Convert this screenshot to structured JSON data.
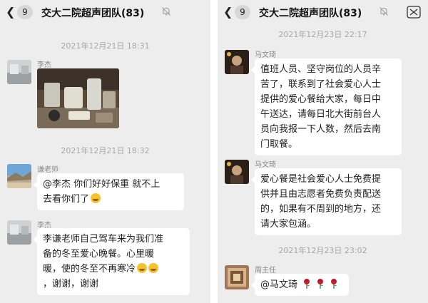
{
  "left_panel": {
    "header": {
      "back_count": "9",
      "title": "交大二院超声团队(83)"
    },
    "timestamps": [
      "2021年12月21日 18:31",
      "2021年12月21日 18:32"
    ],
    "messages": [
      {
        "sender": "李杰",
        "type": "image"
      },
      {
        "sender": "谦老师",
        "text_lines": [
          "@李杰 你们好好保重 就不上",
          "去看你们了"
        ],
        "trailing_emoji": "laughing-crying-emoji"
      },
      {
        "sender": "李杰",
        "text_lines": [
          "李谦老师自己驾车来为我们准",
          "备的冬至爱心晚餐。心里暖",
          "暖，使的冬至不再寒冷",
          "，谢谢，谢谢"
        ],
        "inline_emoji_count": 2
      }
    ]
  },
  "right_panel": {
    "header": {
      "back_count": "9",
      "title": "交大二院超声团队(83)"
    },
    "timestamps": [
      "2021年12月23日 22:17",
      "2021年12月23日 23:02"
    ],
    "messages": [
      {
        "sender": "马文琦",
        "text_lines": [
          "值班人员、坚守岗位的人员辛",
          "苦了，联系到了社会爱心人士",
          "提供的爱心餐给大家，每日中",
          "午送达，请每日北大街前台人",
          "员向我报一下人数，然后去南",
          "门取餐。"
        ]
      },
      {
        "sender": "马文琦",
        "text_lines": [
          "爱心餐是社会爱心人士免费提",
          "供并且由志愿者免费负责配送",
          "的，如果有不周到的地方，还",
          "请大家包涵。"
        ]
      },
      {
        "sender": "周主任",
        "text": "@马文琦",
        "trailing_emoji": "rose-emoji",
        "emoji_count": 3
      }
    ]
  },
  "icons": {
    "back": "chevron-left-icon",
    "mute": "mute-bell-icon",
    "more": "more-icon"
  },
  "colors": {
    "chat_bg": "#ededed",
    "bubble": "#ffffff",
    "timestamp": "#a8a8a8"
  }
}
